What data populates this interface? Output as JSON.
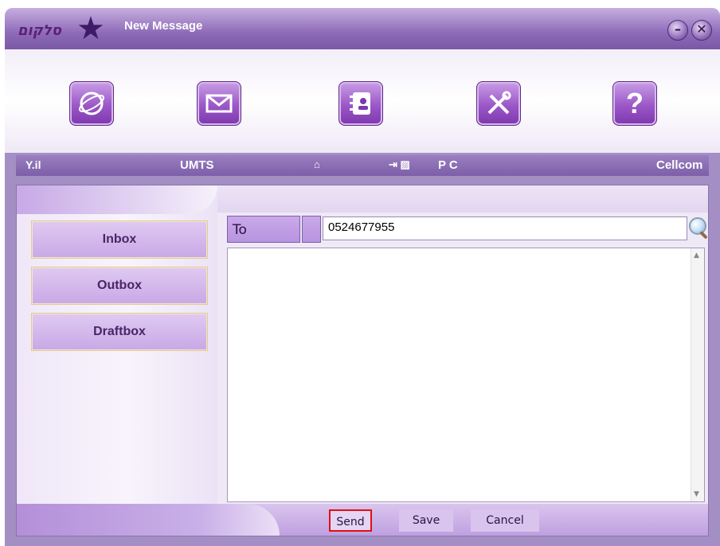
{
  "window": {
    "title": "New Message",
    "logo_text": "סלקום"
  },
  "toolbar": {
    "icons": [
      "internet-icon",
      "messages-icon",
      "contacts-icon",
      "settings-icon",
      "help-icon"
    ]
  },
  "status": {
    "signal": "Y.il",
    "network_type": "UMTS",
    "connection": "P C",
    "carrier": "Cellcom"
  },
  "sidebar": {
    "items": [
      {
        "label": "Inbox"
      },
      {
        "label": "Outbox"
      },
      {
        "label": "Draftbox"
      }
    ]
  },
  "compose": {
    "to_label": "To",
    "to_value": "0524677955",
    "body": ""
  },
  "actions": {
    "send": "Send",
    "save": "Save",
    "cancel": "Cancel"
  },
  "colors": {
    "accent": "#8e6bb8",
    "highlight": "#e01010"
  }
}
